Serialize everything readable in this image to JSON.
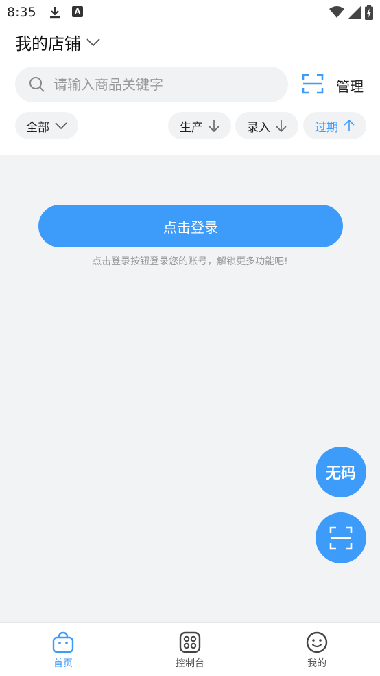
{
  "status_bar": {
    "time": "8:35"
  },
  "header": {
    "store_title": "我的店铺"
  },
  "search": {
    "placeholder": "请输入商品关键字",
    "manage_label": "管理"
  },
  "filters": {
    "all_label": "全部",
    "production_label": "生产",
    "entry_label": "录入",
    "expiry_label": "过期"
  },
  "main": {
    "login_button": "点击登录",
    "login_hint": "点击登录按钮登录您的账号，解锁更多功能吧!"
  },
  "fab": {
    "no_code_label": "无码"
  },
  "bottom_nav": {
    "items": [
      {
        "label": "首页",
        "icon": "bag-icon",
        "active": true
      },
      {
        "label": "控制台",
        "icon": "grid-icon",
        "active": false
      },
      {
        "label": "我的",
        "icon": "smile-icon",
        "active": false
      }
    ]
  },
  "colors": {
    "accent": "#3d9bf9",
    "background": "#f2f3f5",
    "chip": "#f1f2f4"
  }
}
